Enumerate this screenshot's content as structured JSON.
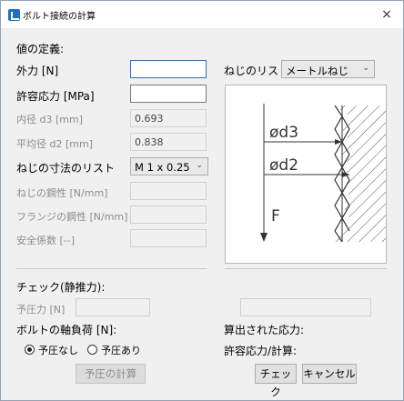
{
  "window": {
    "title": "ボルト接続の計算",
    "close_icon": "×"
  },
  "definition": {
    "header": "値の定義:",
    "external_force_label": "外力 [N]",
    "external_force_value": "",
    "allowable_stress_label": "許容応力 [MPa]",
    "allowable_stress_value": "",
    "inner_diameter_label": "内径 d3 [mm]",
    "inner_diameter_value": "0.693",
    "mean_diameter_label": "平均径 d2 [mm]",
    "mean_diameter_value": "0.838",
    "thread_size_list_label": "ねじの寸法のリスト",
    "thread_size_selected": "M 1 x 0.25",
    "screw_stiffness_label": "ねじの鋼性 [N/mm]",
    "flange_stiffness_label": "フランジの鋼性 [N/mm]",
    "safety_factor_label": "安全係数 [--]"
  },
  "thread_list": {
    "label": "ねじのリスト",
    "selected": "メートルねじ"
  },
  "diagram": {
    "d3_label": "ød3",
    "d2_label": "ød2",
    "force_label": "F"
  },
  "check_static": {
    "header": "チェック(静推力):",
    "preload_label": "予圧力 [N]"
  },
  "axial_load": {
    "header": "ボルトの軸負荷 [N]:",
    "no_preload": "予圧なし",
    "with_preload": "予圧あり",
    "selected": "予圧なし"
  },
  "results": {
    "calculated_stress_label": "算出された応力:",
    "allowable_ratio_label": "許容応力/計算:"
  },
  "buttons": {
    "preload_calc": "予圧の計算",
    "check": "チェック",
    "cancel": "キャンセル"
  }
}
